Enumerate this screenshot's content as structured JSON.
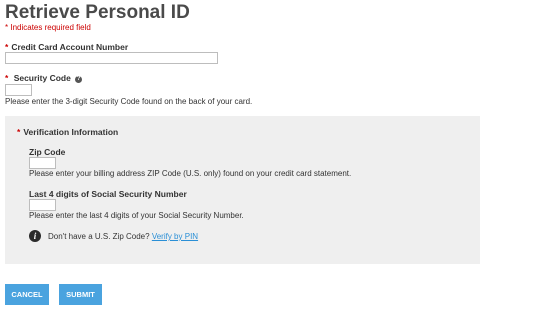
{
  "page": {
    "title": "Retrieve Personal ID",
    "required_note": "Indicates required field",
    "required_marker": "*"
  },
  "fields": {
    "credit_card": {
      "label": "Credit Card Account Number",
      "value": ""
    },
    "security_code": {
      "label": "Security Code",
      "value": "",
      "help_icon": "question-circle-icon",
      "help_text": "Please enter the 3-digit Security Code found on the back of your card."
    }
  },
  "verification": {
    "title": "Verification Information",
    "zip": {
      "label": "Zip Code",
      "value": "",
      "help_text": "Please enter your billing address ZIP Code (U.S. only) found on your credit card statement."
    },
    "ssn": {
      "label": "Last 4 digits of Social Security Number",
      "value": "",
      "help_text": "Please enter the last 4 digits of your Social Security Number."
    },
    "no_zip": {
      "icon": "info-icon",
      "text": "Don't have a U.S. Zip Code?",
      "link": "Verify by PIN"
    }
  },
  "buttons": {
    "cancel": "CANCEL",
    "submit": "SUBMIT"
  },
  "colors": {
    "accent": "#4aa3df",
    "required": "#cc0000",
    "panel": "#efefef",
    "link": "#2a8fd6"
  }
}
